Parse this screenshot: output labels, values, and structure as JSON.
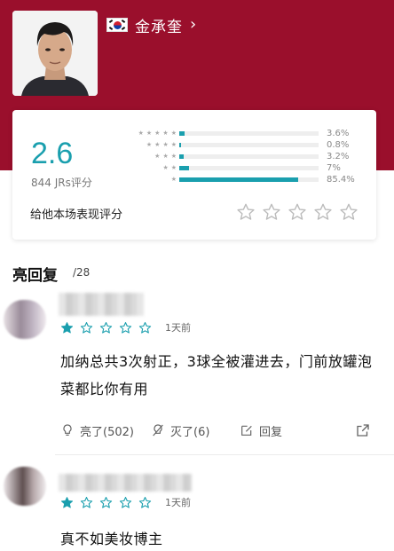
{
  "player": {
    "name": "金承奎",
    "nationality_flag": "south-korea-flag-icon"
  },
  "rating": {
    "score": "2.6",
    "count_label": "844 JRs评分",
    "rate_prompt": "给他本场表现评分",
    "distribution": [
      {
        "stars": 5,
        "percent_label": "3.6%",
        "percent": 3.6
      },
      {
        "stars": 4,
        "percent_label": "0.8%",
        "percent": 0.8
      },
      {
        "stars": 3,
        "percent_label": "3.2%",
        "percent": 3.2
      },
      {
        "stars": 2,
        "percent_label": "7%",
        "percent": 7
      },
      {
        "stars": 1,
        "percent_label": "85.4%",
        "percent": 85.4
      }
    ]
  },
  "comments_section": {
    "title": "亮回复",
    "count": "/28"
  },
  "comments": [
    {
      "rating": 1,
      "time": "1天前",
      "text": "加纳总共3次射正，3球全被灌进去，门前放罐泡菜都比你有用",
      "like_label": "亮了(502)",
      "dislike_label": "灭了(6)",
      "reply_label": "回复"
    },
    {
      "rating": 1,
      "time": "1天前",
      "text": "真不如美妆博主"
    }
  ],
  "colors": {
    "header_bg": "#9a0f2c",
    "accent": "#1a9fae",
    "star_empty": "#bbbbbb"
  }
}
